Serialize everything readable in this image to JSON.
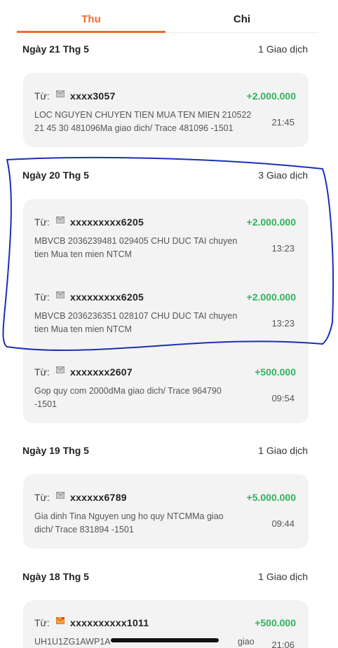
{
  "tabs": {
    "income": "Thu",
    "expense": "Chi"
  },
  "from_label": "Từ:",
  "days": [
    {
      "title": "Ngày 21 Thg 5",
      "count": "1 Giao dịch",
      "transactions": [
        {
          "sender": "xxxx3057",
          "amount": "+2.000.000",
          "desc_line1": "LOC NGUYEN CHUYEN TIEN MUA TEN MIEN 210522",
          "desc_line2": "21 45 30 481096Ma giao dich/ Trace 481096 -1501",
          "time": "21:45",
          "icon": "envelope-gray-icon"
        }
      ]
    },
    {
      "title": "Ngày 20 Thg 5",
      "count": "3 Giao dịch",
      "transactions": [
        {
          "sender": "xxxxxxxxx6205",
          "amount": "+2.000.000",
          "desc_line1": "MBVCB 2036239481 029405 CHU DUC TAI chuyen",
          "desc_line2": "tien Mua ten mien NTCM",
          "time": "13:23",
          "icon": "envelope-gray-icon"
        },
        {
          "sender": "xxxxxxxxx6205",
          "amount": "+2.000.000",
          "desc_line1": "MBVCB 2036236351 028107 CHU DUC TAI chuyen",
          "desc_line2": "tien Mua ten mien NTCM",
          "time": "13:23",
          "icon": "envelope-gray-icon"
        },
        {
          "sender": "xxxxxxx2607",
          "amount": "+500.000",
          "desc_line1": "Gop quy com 2000dMa giao dich/ Trace 964790",
          "desc_line2": "-1501",
          "time": "09:54",
          "icon": "envelope-gray-icon"
        }
      ]
    },
    {
      "title": "Ngày 19 Thg 5",
      "count": "1 Giao dịch",
      "transactions": [
        {
          "sender": "xxxxxx6789",
          "amount": "+5.000.000",
          "desc_line1": "Gia dinh Tina Nguyen ung ho quy NTCMMa giao",
          "desc_line2": "dich/ Trace 831894 -1501",
          "time": "09:44",
          "icon": "envelope-gray-icon"
        }
      ]
    },
    {
      "title": "Ngày 18 Thg 5",
      "count": "1 Giao dịch",
      "transactions": [
        {
          "sender": "xxxxxxxxxx1011",
          "amount": "+500.000",
          "desc_line1": "UH1U1ZG1AWP1A",
          "desc_line2": "",
          "desc_tail": "giao dich/",
          "time": "21:06",
          "icon": "envelope-orange-icon"
        }
      ]
    }
  ],
  "colors": {
    "accent": "#ee6a2c",
    "amount_positive": "#2fb35a",
    "annotation_stroke": "#1a2fb8",
    "card_bg": "#f3f3f3"
  }
}
